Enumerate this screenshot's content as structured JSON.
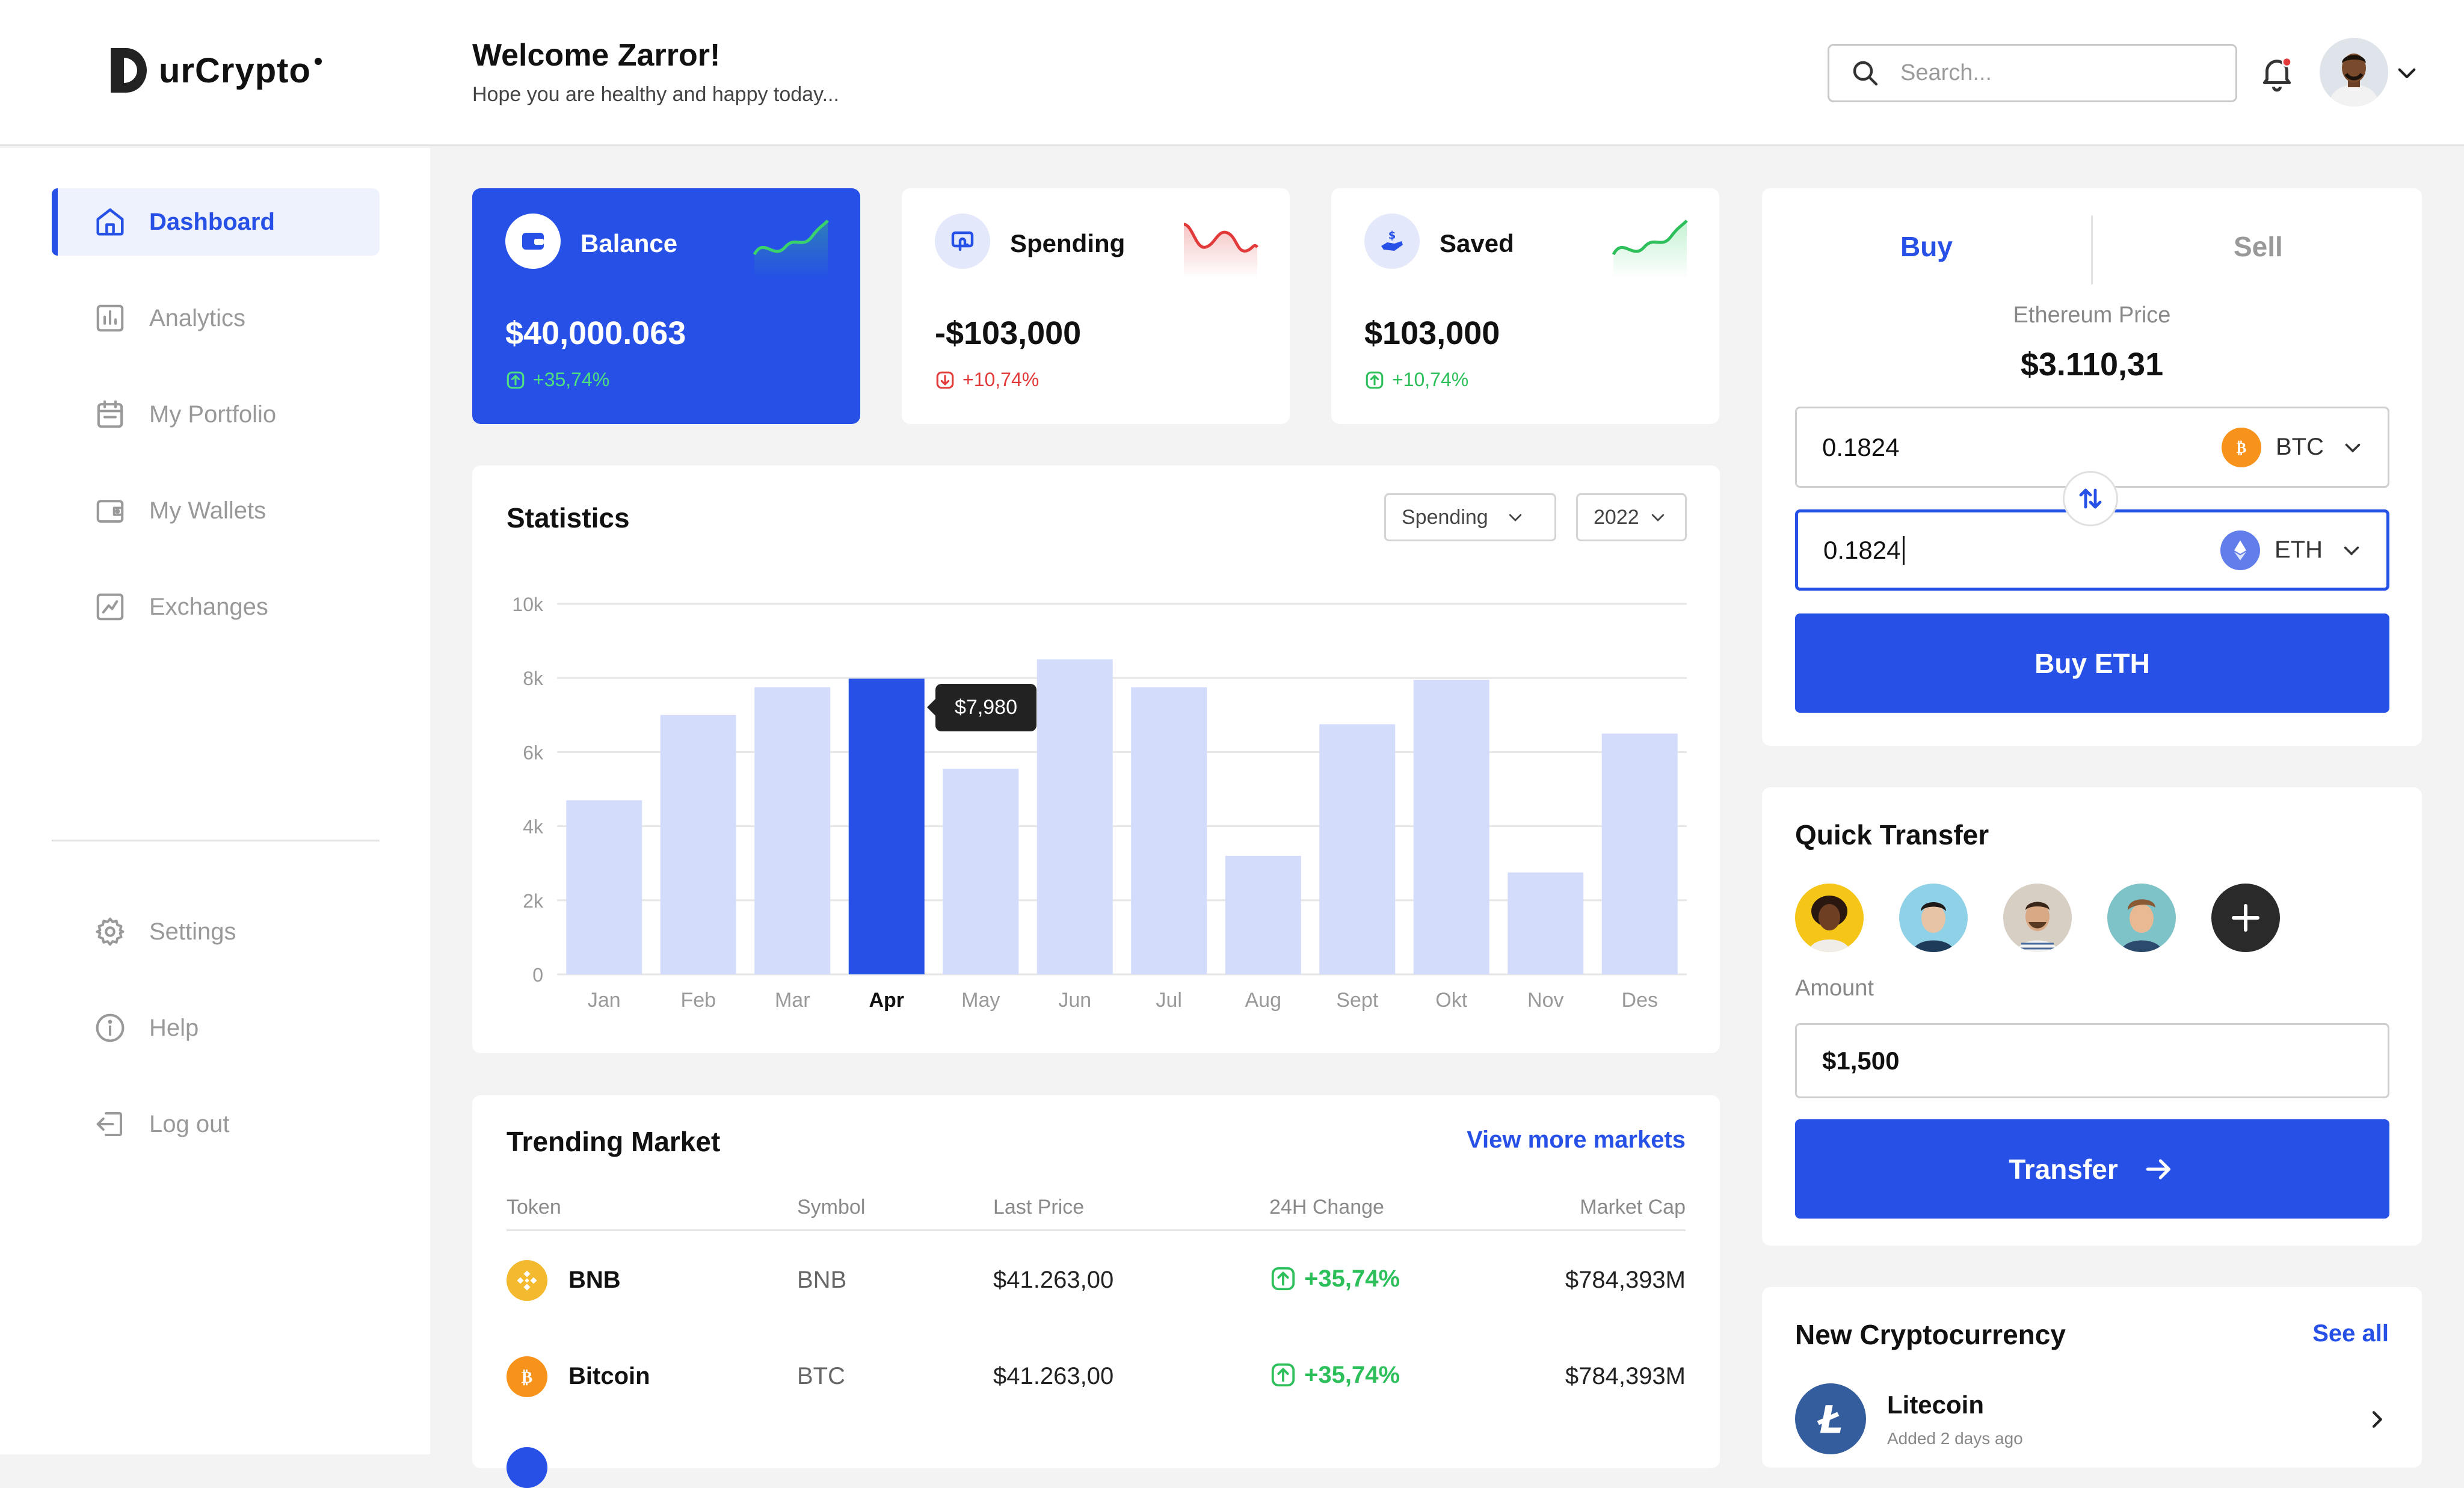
{
  "brand": {
    "name": "urCrypto"
  },
  "header": {
    "welcome": "Welcome Zarror!",
    "subtitle": "Hope you are healthy and happy today...",
    "search_placeholder": "Search..."
  },
  "sidebar": {
    "items": [
      {
        "label": "Dashboard",
        "icon": "home-icon",
        "active": true
      },
      {
        "label": "Analytics",
        "icon": "analytics-icon"
      },
      {
        "label": "My Portfolio",
        "icon": "calendar-icon"
      },
      {
        "label": "My Wallets",
        "icon": "wallet-icon"
      },
      {
        "label": "Exchanges",
        "icon": "trend-icon"
      }
    ],
    "bottom_items": [
      {
        "label": "Settings",
        "icon": "gear-icon"
      },
      {
        "label": "Help",
        "icon": "info-icon"
      },
      {
        "label": "Log out",
        "icon": "logout-icon"
      }
    ]
  },
  "cards": [
    {
      "title": "Balance",
      "amount": "$40,000.063",
      "change": "+35,74%",
      "trend": "up"
    },
    {
      "title": "Spending",
      "amount": "-$103,000",
      "change": "+10,74%",
      "trend": "down"
    },
    {
      "title": "Saved",
      "amount": "$103,000",
      "change": "+10,74%",
      "trend": "up"
    }
  ],
  "statistics": {
    "title": "Statistics",
    "filter": "Spending",
    "year": "2022",
    "tooltip": "$7,980"
  },
  "chart_data": {
    "type": "bar",
    "categories": [
      "Jan",
      "Feb",
      "Mar",
      "Apr",
      "May",
      "Jun",
      "Jul",
      "Aug",
      "Sept",
      "Okt",
      "Nov",
      "Des"
    ],
    "values": [
      4700,
      7000,
      7750,
      7980,
      5550,
      8500,
      7750,
      3200,
      6750,
      7950,
      2750,
      6500
    ],
    "highlight": "Apr",
    "yticks": [
      "0",
      "2k",
      "4k",
      "6k",
      "8k",
      "10k"
    ],
    "ylim": [
      0,
      10000
    ],
    "colors": {
      "bar": "#d3dcfb",
      "highlight": "#2650e6"
    },
    "grid": true
  },
  "market": {
    "title": "Trending Market",
    "view_more": "View more markets",
    "columns": [
      "Token",
      "Symbol",
      "Last Price",
      "24H Change",
      "Market Cap"
    ],
    "rows": [
      {
        "token": "BNB",
        "symbol": "BNB",
        "price": "$41.263,00",
        "change": "+35,74%",
        "cap": "$784,393M",
        "icon": "bnb-icon"
      },
      {
        "token": "Bitcoin",
        "symbol": "BTC",
        "price": "$41.263,00",
        "change": "+35,74%",
        "cap": "$784,393M",
        "icon": "bitcoin-icon"
      }
    ]
  },
  "trade": {
    "tab_buy": "Buy",
    "tab_sell": "Sell",
    "price_label": "Ethereum Price",
    "price": "$3.110,31",
    "from_value": "0.1824",
    "from_currency": "BTC",
    "to_value": "0.1824",
    "to_currency": "ETH",
    "button": "Buy ETH"
  },
  "quick_transfer": {
    "title": "Quick Transfer",
    "amount_label": "Amount",
    "amount_value": "$1,500",
    "button": "Transfer"
  },
  "new_crypto": {
    "title": "New Cryptocurrency",
    "see_all": "See all",
    "item_name": "Litecoin",
    "item_added": "Added 2 days ago"
  },
  "colors": {
    "accent": "#2650e6",
    "up": "#2cbf5a",
    "down": "#e23a3a"
  }
}
